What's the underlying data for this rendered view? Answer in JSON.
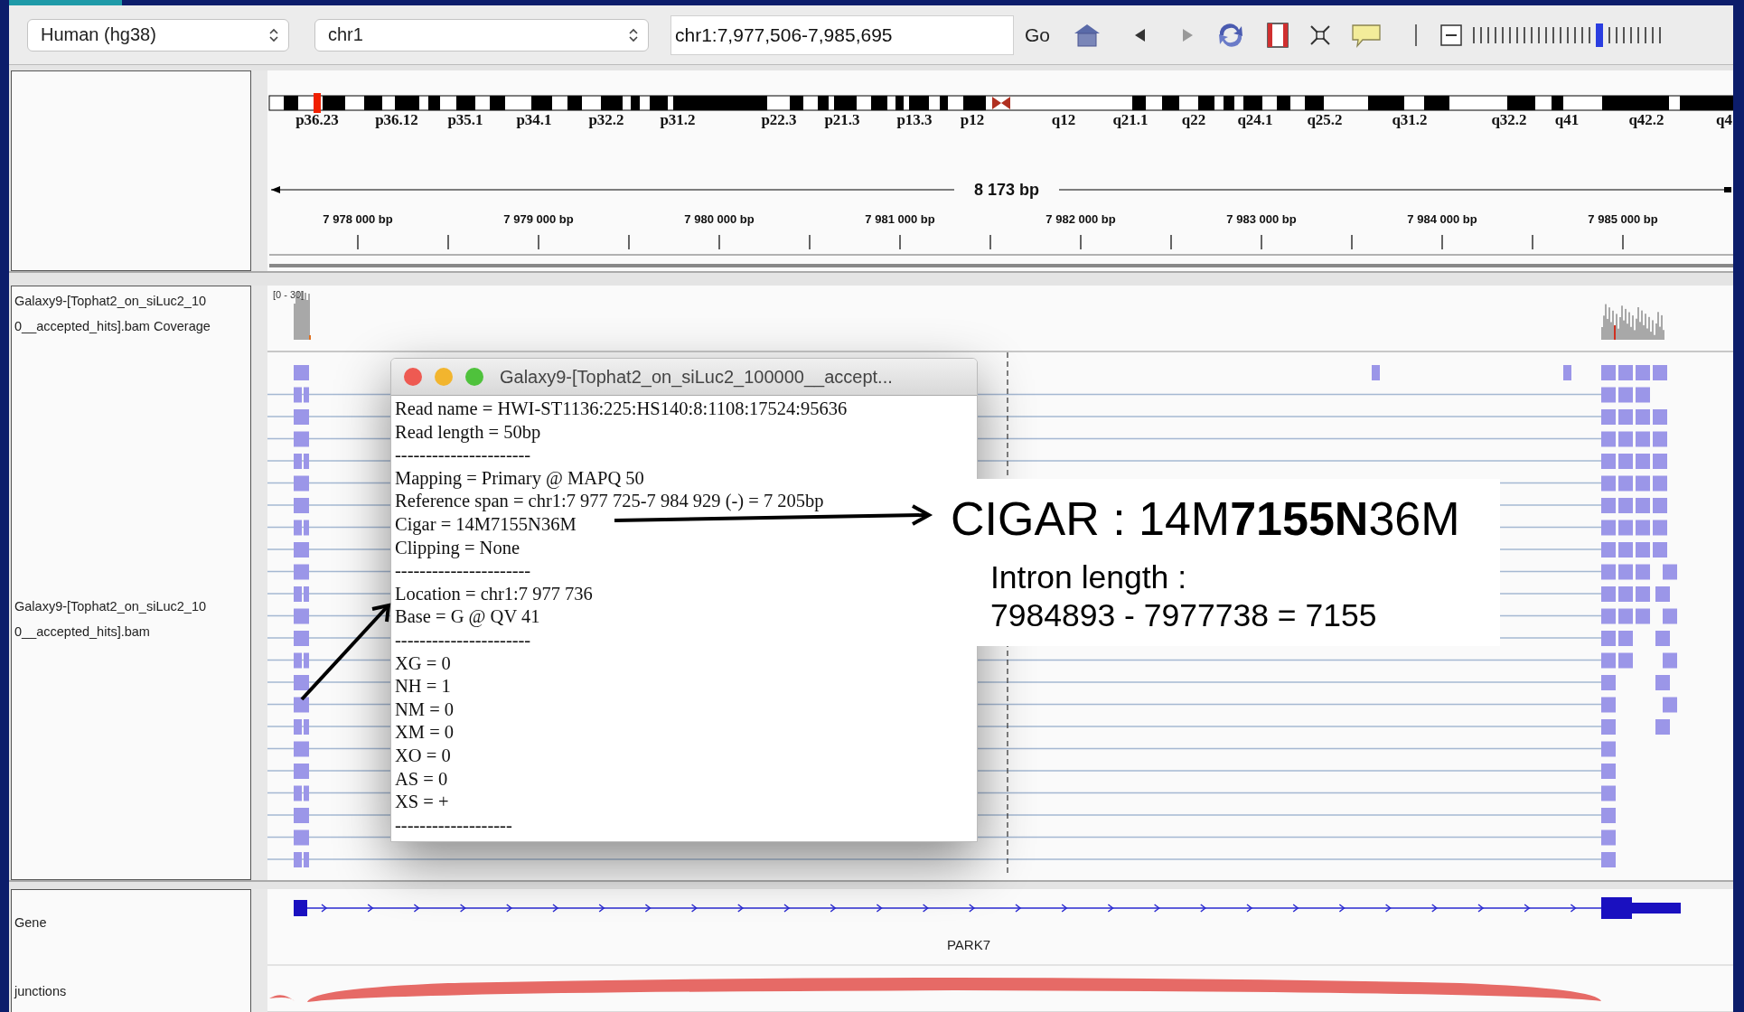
{
  "toolbar": {
    "genome": "Human (hg38)",
    "chromosome": "chr1",
    "locus": "chr1:7,977,506-7,985,695",
    "go": "Go",
    "navigation": [
      {
        "kind": "back",
        "disabled": false
      },
      {
        "kind": "forward",
        "disabled": true
      }
    ],
    "zoom": {
      "level": 0.68
    }
  },
  "ideogram": {
    "bands": [
      "p36.23",
      "p36.12",
      "p35.1",
      "p34.1",
      "p32.2",
      "p31.2",
      "p22.3",
      "p21.3",
      "p13.3",
      "p12",
      "q12",
      "q21.1",
      "q22",
      "q24.1",
      "q25.2",
      "q31.2",
      "q32.2",
      "q41",
      "q42.2",
      "q4"
    ]
  },
  "ruler": {
    "span": "8 173 bp",
    "ticks": [
      "7 978 000 bp",
      "7 979 000 bp",
      "7 980 000 bp",
      "7 981 000 bp",
      "7 982 000 bp",
      "7 983 000 bp",
      "7 984 000 bp",
      "7 985 000 bp"
    ]
  },
  "tracks": [
    {
      "kind": "coverage",
      "name_lines": [
        "Galaxy9-[Tophat2_on_siLuc2_10",
        "0__accepted_hits].bam Coverage"
      ],
      "range": "[0 - 30]"
    },
    {
      "kind": "alignment",
      "name_lines": [
        "Galaxy9-[Tophat2_on_siLuc2_10",
        "0__accepted_hits].bam"
      ]
    },
    {
      "kind": "gene",
      "name_lines": [
        "Gene"
      ],
      "feature": "PARK7"
    },
    {
      "kind": "junctions",
      "name_lines": [
        "junctions"
      ]
    }
  ],
  "popup": {
    "title": "Galaxy9-[Tophat2_on_siLuc2_100000__accept...",
    "lines": [
      "Read name = HWI-ST1136:225:HS140:8:1108:17524:95636",
      "Read length = 50bp",
      "----------------------",
      "Mapping = Primary @ MAPQ 50",
      "Reference span = chr1:7 977 725-7 984 929 (-) = 7 205bp",
      "Cigar = 14M7155N36M",
      "Clipping = None",
      "----------------------",
      "Location = chr1:7 977 736",
      "Base = G @ QV 41",
      "----------------------",
      "XG = 0",
      "NH = 1",
      "NM = 0",
      "XM = 0",
      "XO = 0",
      "AS = 0",
      "XS = +",
      "-------------------"
    ]
  },
  "annotation": {
    "headline": "CIGAR : 14M**7155N**36M",
    "caption_lines": [
      "Intron length :",
      "7984893 - 7977738 = 7155"
    ]
  }
}
